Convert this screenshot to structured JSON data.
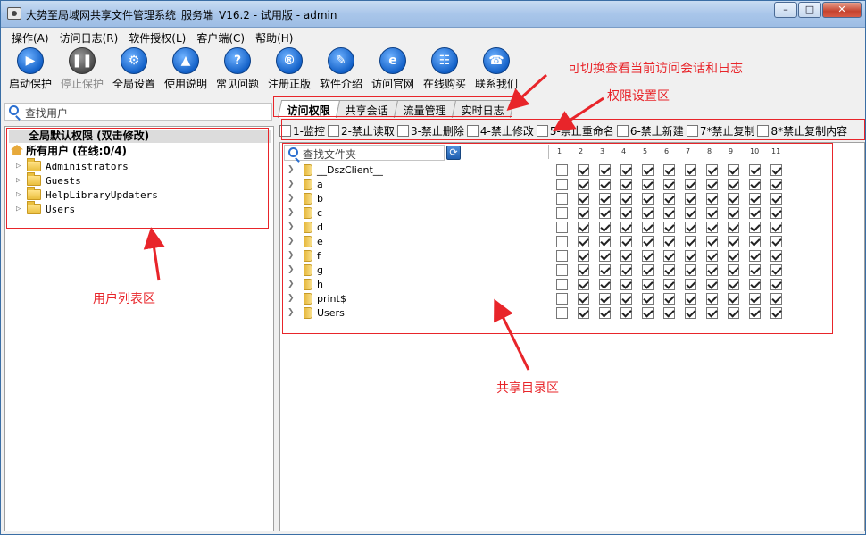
{
  "window": {
    "title": "大势至局域网共享文件管理系统_服务端_V16.2 - 试用版 - admin",
    "minimize_icon": "minimize-icon",
    "maximize_icon": "maximize-icon",
    "close_icon": "close-icon"
  },
  "menu": [
    "操作(A)",
    "访问日志(R)",
    "软件授权(L)",
    "客户端(C)",
    "帮助(H)"
  ],
  "toolbar": [
    {
      "label": "启动保护",
      "icon": "play-icon",
      "enabled": true
    },
    {
      "label": "停止保护",
      "icon": "pause-icon",
      "enabled": false
    },
    {
      "label": "全局设置",
      "icon": "gear-icon",
      "enabled": true
    },
    {
      "label": "使用说明",
      "icon": "graduation-cap-icon",
      "enabled": true
    },
    {
      "label": "常见问题",
      "icon": "question-icon",
      "enabled": true
    },
    {
      "label": "注册正版",
      "icon": "registered-icon",
      "enabled": true
    },
    {
      "label": "软件介绍",
      "icon": "document-icon",
      "enabled": true
    },
    {
      "label": "访问官网",
      "icon": "browser-icon",
      "enabled": true
    },
    {
      "label": "在线购买",
      "icon": "cart-icon",
      "enabled": true
    },
    {
      "label": "联系我们",
      "icon": "phone-icon",
      "enabled": true
    }
  ],
  "left": {
    "search_placeholder": "查找用户",
    "global_default": "全局默认权限 (双击修改)",
    "all_users": "所有用户 (在线:0/4)",
    "groups": [
      "Administrators",
      "Guests",
      "HelpLibraryUpdaters",
      "Users"
    ]
  },
  "tabs": [
    {
      "label": "访问权限",
      "active": true
    },
    {
      "label": "共享会话",
      "active": false
    },
    {
      "label": "流量管理",
      "active": false
    },
    {
      "label": "实时日志",
      "active": false
    }
  ],
  "permissions": [
    "1-监控",
    "2-禁止读取",
    "3-禁止删除",
    "4-禁止修改",
    "5-禁止重命名",
    "6-禁止新建",
    "7*禁止复制",
    "8*禁止复制内容"
  ],
  "folder_panel": {
    "search_placeholder": "查找文件夹",
    "columns": [
      "1",
      "2",
      "3",
      "4",
      "5",
      "6",
      "7",
      "8",
      "9",
      "10",
      "11"
    ],
    "folders": [
      "__DszClient__",
      "a",
      "b",
      "c",
      "d",
      "e",
      "f",
      "g",
      "h",
      "print$",
      "Users"
    ],
    "checked_pattern": [
      false,
      true,
      true,
      true,
      true,
      true,
      true,
      true,
      true,
      true,
      true
    ]
  },
  "annotations": {
    "tabs_note": "可切换查看当前访问会话和日志",
    "perm_note": "权限设置区",
    "user_list_note": "用户列表区",
    "folder_note": "共享目录区",
    "color": "#e8252a"
  },
  "colors": {
    "titlebar": "#a9c6ea",
    "toolbar_icon": "#1361c8",
    "close_button": "#c5422e"
  }
}
